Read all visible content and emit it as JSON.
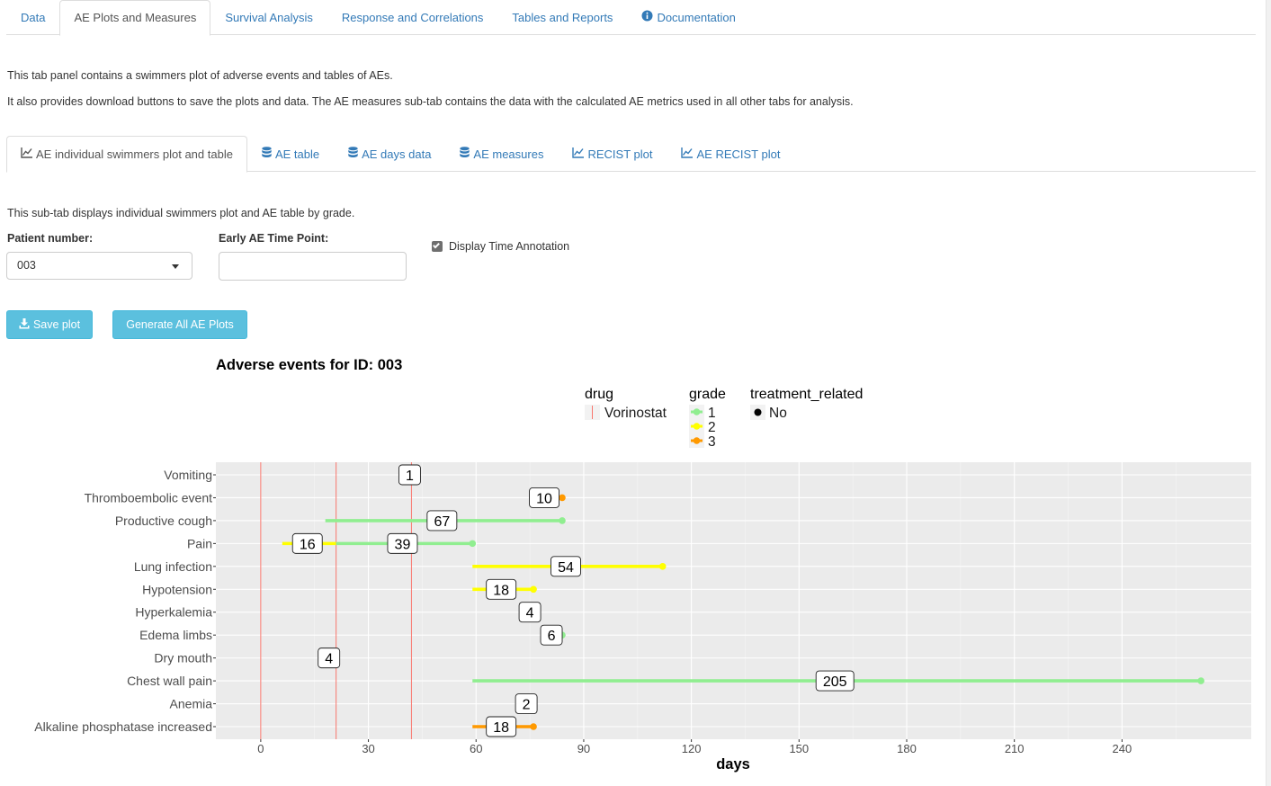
{
  "main_tabs": [
    {
      "label": "Data",
      "active": false
    },
    {
      "label": "AE Plots and Measures",
      "active": true
    },
    {
      "label": "Survival Analysis",
      "active": false
    },
    {
      "label": "Response and Correlations",
      "active": false
    },
    {
      "label": "Tables and Reports",
      "active": false
    },
    {
      "label": "Documentation",
      "active": false,
      "icon": "info-circle-icon"
    }
  ],
  "intro": {
    "line1": "This tab panel contains a swimmers plot of adverse events and tables of AEs.",
    "line2": "It also provides download buttons to save the plots and data. The AE measures sub-tab contains the data with the calculated AE metrics used in all other tabs for analysis."
  },
  "sub_tabs": [
    {
      "label": "AE individual swimmers plot and table",
      "icon": "line-chart-icon",
      "active": true
    },
    {
      "label": "AE table",
      "icon": "database-icon",
      "active": false
    },
    {
      "label": "AE days data",
      "icon": "database-icon",
      "active": false
    },
    {
      "label": "AE measures",
      "icon": "database-icon",
      "active": false
    },
    {
      "label": "RECIST plot",
      "icon": "line-chart-icon",
      "active": false
    },
    {
      "label": "AE RECIST plot",
      "icon": "line-chart-icon",
      "active": false
    }
  ],
  "subtab_desc": "This sub-tab displays individual swimmers plot and AE table by grade.",
  "controls": {
    "patient_label": "Patient number:",
    "patient_value": "003",
    "early_label": "Early AE Time Point:",
    "early_value": "",
    "display_time_label": "Display Time Annotation",
    "display_time_checked": true
  },
  "buttons": {
    "save_plot": "Save plot",
    "save_plot_icon": "download-icon",
    "generate_all": "Generate All AE Plots"
  },
  "chart_data": {
    "type": "swimmer",
    "title": "Adverse events for ID: 003",
    "xlabel": "days",
    "ylabel": "",
    "xlim": [
      -12.5,
      276
    ],
    "xticks": [
      0,
      30,
      60,
      90,
      120,
      150,
      180,
      210,
      240
    ],
    "grid": true,
    "legend_position": "top",
    "legend": {
      "drug": {
        "title": "drug",
        "entries": [
          {
            "label": "Vorinostat",
            "color": "#f8766d"
          }
        ]
      },
      "grade": {
        "title": "grade",
        "entries": [
          {
            "label": "1",
            "color": "#90ee90"
          },
          {
            "label": "2",
            "color": "#ffff00"
          },
          {
            "label": "3",
            "color": "#ff9900"
          }
        ]
      },
      "treatment_related": {
        "title": "treatment_related",
        "entries": [
          {
            "label": "No",
            "color": "#000000"
          }
        ]
      }
    },
    "drug_administration_days": [
      0,
      21,
      42
    ],
    "grade_colors": {
      "1": "#90ee90",
      "2": "#ffff00",
      "3": "#ff9900"
    },
    "categories": [
      "Vomiting",
      "Thromboembolic event",
      "Productive cough",
      "Pain",
      "Lung infection",
      "Hypotension",
      "Hyperkalemia",
      "Edema limbs",
      "Dry mouth",
      "Chest wall pain",
      "Anemia",
      "Alkaline phosphatase increased"
    ],
    "events": [
      {
        "category": "Vomiting",
        "grade": "1",
        "start": 42,
        "end": 42,
        "duration": "1",
        "end_marker": false
      },
      {
        "category": "Thromboembolic event",
        "grade": "3",
        "start": 84,
        "end": 84,
        "duration": "10",
        "end_marker": true
      },
      {
        "category": "Productive cough",
        "grade": "1",
        "start": 18,
        "end": 84,
        "duration": "67",
        "end_marker": true
      },
      {
        "category": "Pain",
        "grade": "2",
        "start": 6,
        "end": 21,
        "duration": "16",
        "end_marker": false
      },
      {
        "category": "Pain",
        "grade": "1",
        "start": 21,
        "end": 59,
        "duration": "39",
        "end_marker": true
      },
      {
        "category": "Lung infection",
        "grade": "2",
        "start": 59,
        "end": 112,
        "duration": "54",
        "end_marker": true
      },
      {
        "category": "Hypotension",
        "grade": "2",
        "start": 59,
        "end": 76,
        "duration": "18",
        "end_marker": true
      },
      {
        "category": "Hyperkalemia",
        "grade": "1",
        "start": 75,
        "end": 75,
        "duration": "4",
        "end_marker": false
      },
      {
        "category": "Edema limbs",
        "grade": "1",
        "start": 84,
        "end": 84,
        "duration": "6",
        "end_marker": true
      },
      {
        "category": "Dry mouth",
        "grade": "1",
        "start": 19,
        "end": 19,
        "duration": "4",
        "end_marker": false
      },
      {
        "category": "Chest wall pain",
        "grade": "1",
        "start": 59,
        "end": 262,
        "duration": "205",
        "end_marker": true
      },
      {
        "category": "Anemia",
        "grade": "1",
        "start": 74,
        "end": 74,
        "duration": "2",
        "end_marker": false
      },
      {
        "category": "Alkaline phosphatase increased",
        "grade": "3",
        "start": 59,
        "end": 76,
        "duration": "18",
        "end_marker": true
      }
    ],
    "duration_labels": [
      {
        "category": "Vomiting",
        "text": "1",
        "x": 41.5
      },
      {
        "category": "Thromboembolic event",
        "text": "10",
        "x": 79
      },
      {
        "category": "Productive cough",
        "text": "67",
        "x": 50.5
      },
      {
        "category": "Pain",
        "text": "16",
        "x": 13
      },
      {
        "category": "Pain",
        "text": "39",
        "x": 39.5
      },
      {
        "category": "Lung infection",
        "text": "54",
        "x": 85
      },
      {
        "category": "Hypotension",
        "text": "18",
        "x": 67
      },
      {
        "category": "Hyperkalemia",
        "text": "4",
        "x": 75
      },
      {
        "category": "Edema limbs",
        "text": "6",
        "x": 81
      },
      {
        "category": "Dry mouth",
        "text": "4",
        "x": 19
      },
      {
        "category": "Chest wall pain",
        "text": "205",
        "x": 160
      },
      {
        "category": "Anemia",
        "text": "2",
        "x": 74
      },
      {
        "category": "Alkaline phosphatase increased",
        "text": "18",
        "x": 67
      }
    ]
  }
}
